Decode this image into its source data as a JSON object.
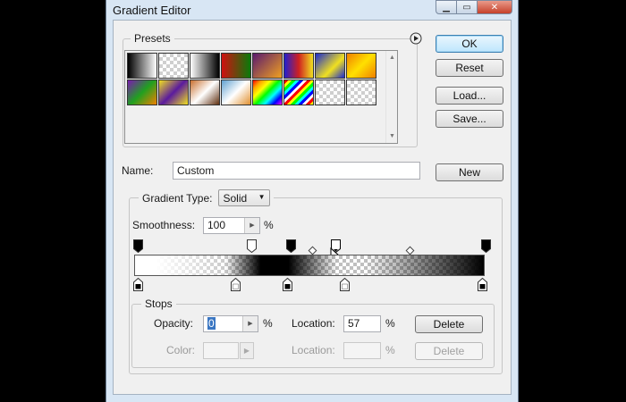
{
  "window": {
    "title": "Gradient Editor",
    "min_glyph": "▁",
    "max_glyph": "▭",
    "close_glyph": "✕"
  },
  "buttons": {
    "ok": "OK",
    "reset": "Reset",
    "load": "Load...",
    "save": "Save...",
    "new": "New",
    "delete": "Delete",
    "delete_disabled": "Delete"
  },
  "presets": {
    "label": "Presets",
    "menu_icon": "play-circle-icon"
  },
  "name": {
    "label": "Name:",
    "value": "Custom"
  },
  "gradient_type": {
    "label": "Gradient Type:",
    "value": "Solid"
  },
  "smoothness": {
    "label": "Smoothness:",
    "value": "100",
    "unit": "%"
  },
  "stops": {
    "label": "Stops",
    "opacity_label": "Opacity:",
    "opacity_value": "0",
    "opacity_unit": "%",
    "opacity_location_label": "Location:",
    "opacity_location_value": "57",
    "opacity_location_unit": "%",
    "color_label": "Color:",
    "color_location_label": "Location:",
    "color_location_unit": "%"
  },
  "colors": {
    "accent": "#3c7fb1",
    "window_frame": "#d8e6f4"
  }
}
